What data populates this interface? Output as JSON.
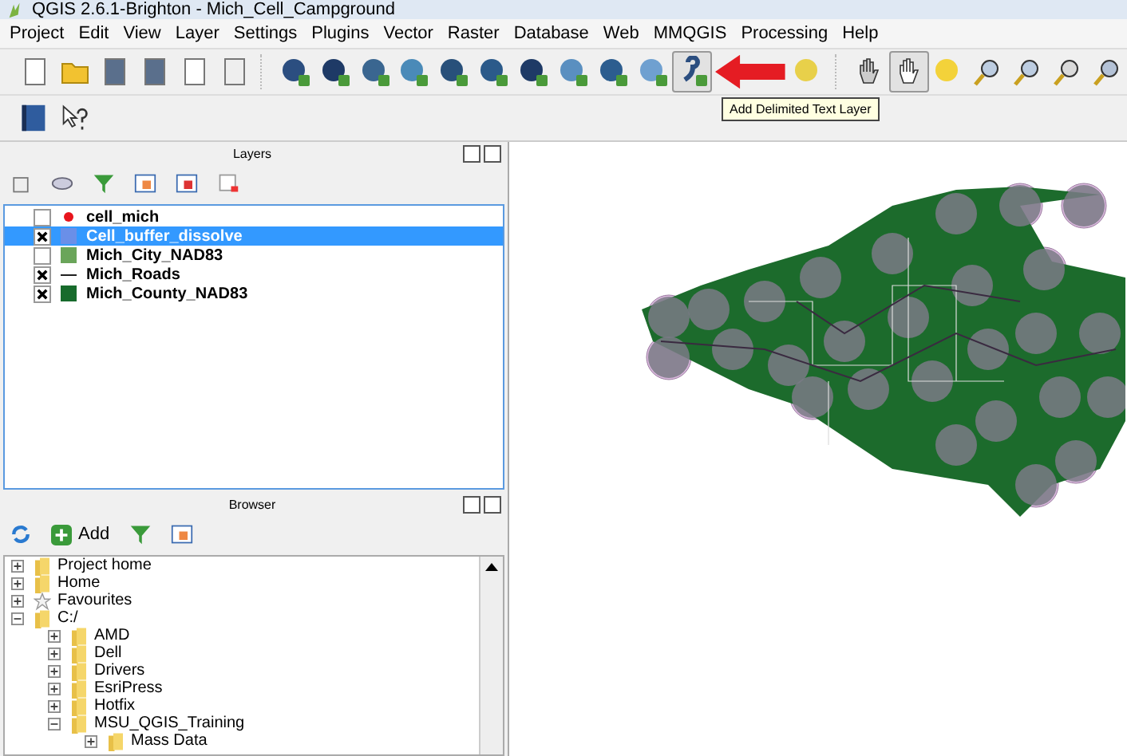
{
  "window": {
    "title": "QGIS 2.6.1-Brighton - Mich_Cell_Campground"
  },
  "menu": [
    "Project",
    "Edit",
    "View",
    "Layer",
    "Settings",
    "Plugins",
    "Vector",
    "Raster",
    "Database",
    "Web",
    "MMQGIS",
    "Processing",
    "Help"
  ],
  "toolbar": [
    {
      "kind": "new",
      "selected": false
    },
    {
      "kind": "open",
      "selected": false
    },
    {
      "kind": "save",
      "selected": false
    },
    {
      "kind": "saveas",
      "selected": false
    },
    {
      "kind": "composer",
      "selected": false
    },
    {
      "kind": "manager",
      "selected": false
    },
    {
      "kind": "sep"
    },
    {
      "kind": "vector",
      "selected": false
    },
    {
      "kind": "raster",
      "selected": false
    },
    {
      "kind": "postgis",
      "selected": false
    },
    {
      "kind": "spatialite",
      "selected": false
    },
    {
      "kind": "mssql",
      "selected": false
    },
    {
      "kind": "oracle",
      "selected": false
    },
    {
      "kind": "db2",
      "selected": false
    },
    {
      "kind": "wms",
      "selected": false
    },
    {
      "kind": "wcs",
      "selected": false
    },
    {
      "kind": "wfs",
      "selected": false
    },
    {
      "kind": "delimited",
      "selected": true
    },
    {
      "kind": "newlayer",
      "selected": false
    },
    {
      "kind": "sep"
    },
    {
      "kind": "touch",
      "selected": false
    },
    {
      "kind": "pan",
      "selected": true
    },
    {
      "kind": "pantosel",
      "selected": false
    },
    {
      "kind": "zoomin",
      "selected": false
    },
    {
      "kind": "zoomout",
      "selected": false
    },
    {
      "kind": "zoom11",
      "selected": false
    },
    {
      "kind": "zoomfull",
      "selected": false
    }
  ],
  "tooltip": "Add Delimited Text Layer",
  "layers_panel": {
    "title": "Layers",
    "layers": [
      {
        "name": "cell_mich",
        "checked": false,
        "kind": "point",
        "color": "#e8141c",
        "selected": false
      },
      {
        "name": "Cell_buffer_dissolve",
        "checked": true,
        "kind": "fill",
        "color": "#6a8fe8",
        "selected": true
      },
      {
        "name": "Mich_City_NAD83",
        "checked": false,
        "kind": "fill",
        "color": "#6aa55a",
        "selected": false
      },
      {
        "name": "Mich_Roads",
        "checked": true,
        "kind": "line",
        "color": "#202020",
        "selected": false
      },
      {
        "name": "Mich_County_NAD83",
        "checked": true,
        "kind": "fill",
        "color": "#176b2c",
        "selected": false
      }
    ]
  },
  "browser_panel": {
    "title": "Browser",
    "add_button": "Add",
    "tree": [
      {
        "label": "Project home",
        "kind": "folder",
        "expanded": false
      },
      {
        "label": "Home",
        "kind": "folder",
        "expanded": false
      },
      {
        "label": "Favourites",
        "kind": "star",
        "expanded": false
      },
      {
        "label": "C:/",
        "kind": "folder",
        "expanded": true,
        "children": [
          {
            "label": "AMD",
            "kind": "folder",
            "expanded": false
          },
          {
            "label": "Dell",
            "kind": "folder",
            "expanded": false
          },
          {
            "label": "Drivers",
            "kind": "folder",
            "expanded": false
          },
          {
            "label": "EsriPress",
            "kind": "folder",
            "expanded": false
          },
          {
            "label": "Hotfix",
            "kind": "folder",
            "expanded": false
          },
          {
            "label": "MSU_QGIS_Training",
            "kind": "folder",
            "expanded": true,
            "children": [
              {
                "label": "Mass Data",
                "kind": "folder",
                "expanded": false
              }
            ]
          }
        ]
      }
    ]
  }
}
